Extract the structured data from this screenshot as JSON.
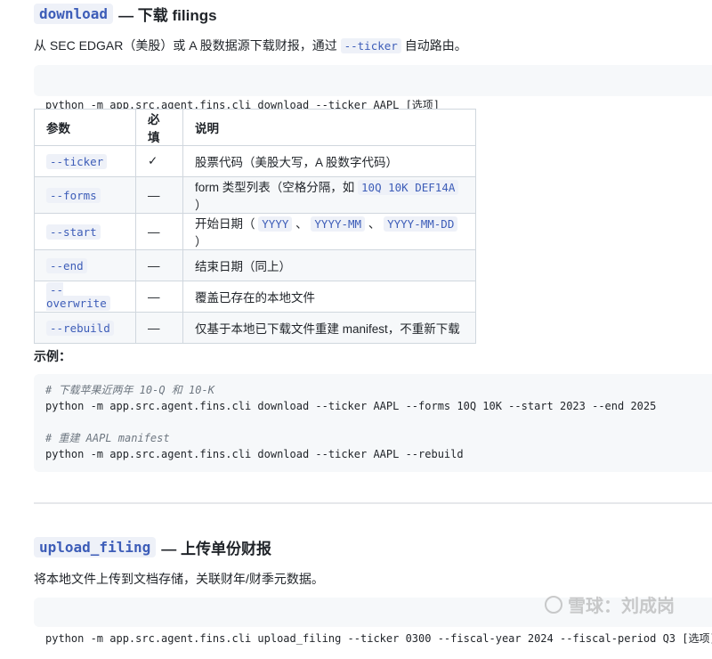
{
  "download_section": {
    "command": "download",
    "title": "— 下载 filings",
    "desc_before": "从 SEC EDGAR（美股）或 A 股数据源下载财报，通过",
    "desc_code": "--ticker",
    "desc_after": "自动路由。",
    "usage": "python -m app.src.agent.fins.cli download --ticker AAPL [选项]"
  },
  "params_table": {
    "headers": [
      "参数",
      "必填",
      "说明"
    ],
    "rows": [
      {
        "param": "--ticker",
        "required": "✓",
        "desc_parts": [
          {
            "t": "股票代码（美股大写，A 股数字代码）"
          }
        ]
      },
      {
        "param": "--forms",
        "required": "—",
        "desc_parts": [
          {
            "t": "form 类型列表（空格分隔，如 "
          },
          {
            "c": "10Q 10K DEF14A"
          },
          {
            "t": " ）"
          }
        ]
      },
      {
        "param": "--start",
        "required": "—",
        "desc_parts": [
          {
            "t": "开始日期（ "
          },
          {
            "c": "YYYY"
          },
          {
            "t": " 、 "
          },
          {
            "c": "YYYY-MM"
          },
          {
            "t": " 、 "
          },
          {
            "c": "YYYY-MM-DD"
          },
          {
            "t": " ）"
          }
        ]
      },
      {
        "param": "--end",
        "required": "—",
        "desc_parts": [
          {
            "t": "结束日期（同上）"
          }
        ]
      },
      {
        "param": "--overwrite",
        "required": "—",
        "desc_parts": [
          {
            "t": "覆盖已存在的本地文件"
          }
        ]
      },
      {
        "param": "--rebuild",
        "required": "—",
        "desc_parts": [
          {
            "t": "仅基于本地已下载文件重建 manifest，不重新下载"
          }
        ]
      }
    ]
  },
  "example_label": "示例：",
  "example_code": [
    {
      "text": "# 下载苹果近两年 10-Q 和 10-K",
      "comment": true
    },
    {
      "text": "python -m app.src.agent.fins.cli download --ticker AAPL --forms 10Q 10K --start 2023 --end 2025",
      "comment": false
    },
    {
      "text": "",
      "comment": false
    },
    {
      "text": "# 重建 AAPL manifest",
      "comment": true
    },
    {
      "text": "python -m app.src.agent.fins.cli download --ticker AAPL --rebuild",
      "comment": false
    }
  ],
  "upload_section": {
    "command": "upload_filing",
    "title": "— 上传单份财报",
    "desc": "将本地文件上传到文档存储，关联财年/财季元数据。",
    "usage": "python -m app.src.agent.fins.cli upload_filing --ticker 0300 --fiscal-year 2024 --fiscal-period Q3 [选项]"
  },
  "watermark": "雪球：刘成岗"
}
